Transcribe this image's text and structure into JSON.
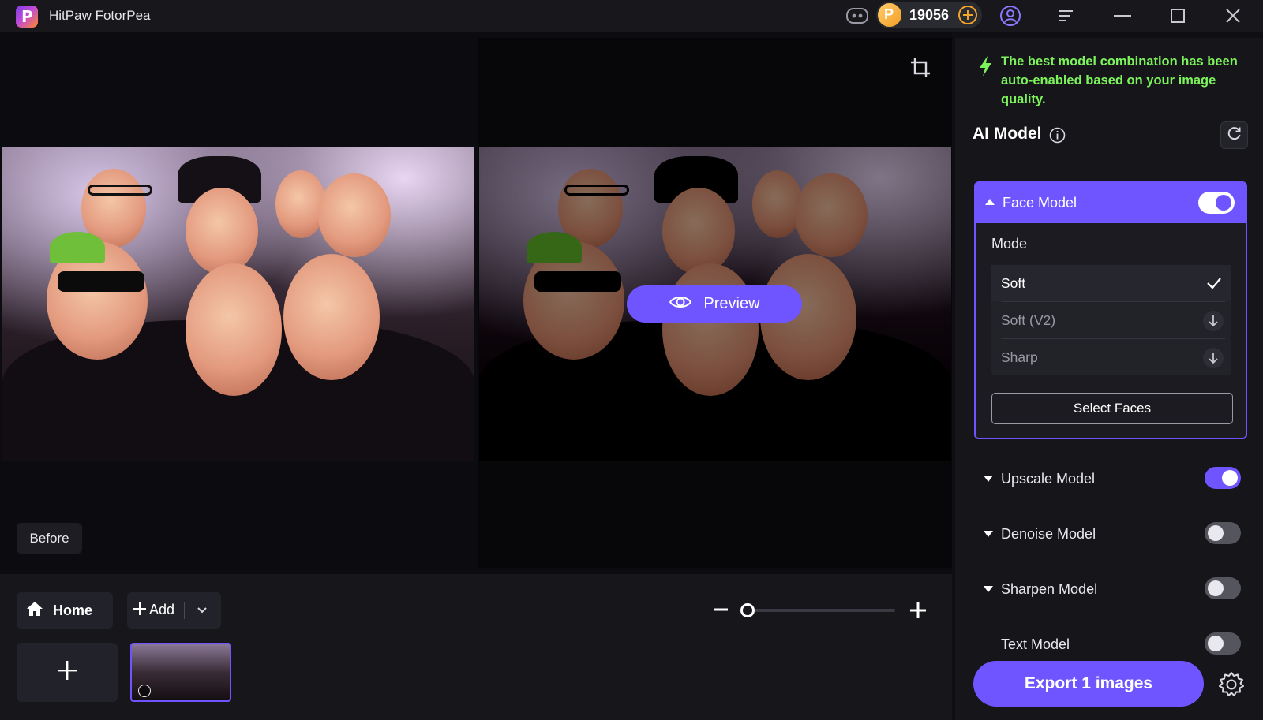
{
  "titlebar": {
    "app_title": "HitPaw FotorPea",
    "coins": "19056",
    "icons": [
      "discord-icon",
      "coin-icon",
      "add-coins-icon",
      "account-icon",
      "menu-icon",
      "minimize-icon",
      "maximize-icon",
      "close-icon"
    ]
  },
  "canvas": {
    "preview_label": "Preview",
    "before_label": "Before"
  },
  "bottom": {
    "home_label": "Home",
    "add_label": "Add",
    "zoom_level": 0.0
  },
  "panel": {
    "notice": "The best model combination has been auto-enabled based on your image quality.",
    "ai_model_title": "AI Model",
    "face_model": {
      "label": "Face Model",
      "enabled": true,
      "mode_label": "Mode",
      "modes": [
        {
          "label": "Soft",
          "state": "selected"
        },
        {
          "label": "Soft (V2)",
          "state": "download"
        },
        {
          "label": "Sharp",
          "state": "download"
        }
      ],
      "select_faces_label": "Select Faces"
    },
    "models": [
      {
        "label": "Upscale Model",
        "enabled": true
      },
      {
        "label": "Denoise Model",
        "enabled": false
      },
      {
        "label": "Sharpen Model",
        "enabled": false
      },
      {
        "label": "Text Model",
        "enabled": false
      }
    ],
    "export_label": "Export 1 images"
  },
  "colors": {
    "accent": "#6f55ff",
    "notice_green": "#7cf35a",
    "coin_orange": "#f3a52a"
  }
}
